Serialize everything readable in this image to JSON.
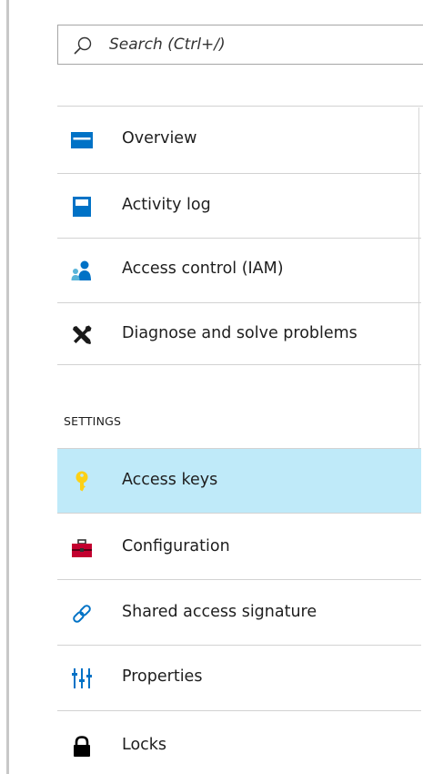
{
  "search": {
    "placeholder": "Search (Ctrl+/)",
    "value": "",
    "icon": "search-icon"
  },
  "nav": {
    "items": [
      {
        "label": "Overview",
        "icon": "overview-icon"
      },
      {
        "label": "Activity log",
        "icon": "activity-log-icon"
      },
      {
        "label": "Access control (IAM)",
        "icon": "people-icon"
      },
      {
        "label": "Diagnose and solve problems",
        "icon": "wrench-screwdriver-icon"
      }
    ]
  },
  "settings": {
    "header": "SETTINGS",
    "items": [
      {
        "label": "Access keys",
        "icon": "key-icon",
        "selected": true
      },
      {
        "label": "Configuration",
        "icon": "toolbox-icon"
      },
      {
        "label": "Shared access signature",
        "icon": "link-icon"
      },
      {
        "label": "Properties",
        "icon": "sliders-icon"
      },
      {
        "label": "Locks",
        "icon": "lock-icon"
      }
    ]
  },
  "colors": {
    "selected_bg": "#bfeaf9",
    "accent_blue": "#0072c6",
    "key_yellow": "#fcd116",
    "toolbox_red": "#c3002f",
    "divider": "#d2d2d2"
  }
}
